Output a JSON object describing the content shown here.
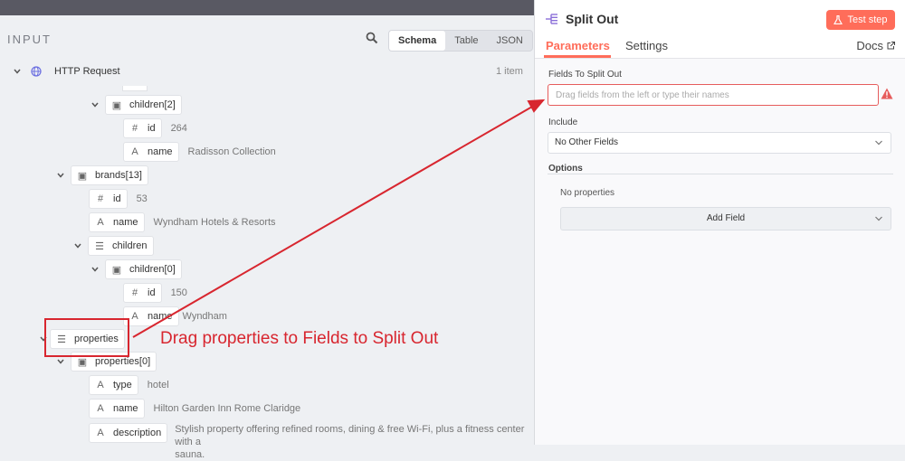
{
  "left_panel": {
    "title": "INPUT",
    "view_tabs": [
      "Schema",
      "Table",
      "JSON"
    ],
    "active_view": "Schema",
    "root": {
      "label": "HTTP Request",
      "count": "1 item"
    },
    "tree": [
      {
        "type": "object",
        "label": "children[2]"
      },
      {
        "type": "number",
        "label": "id",
        "value": "264"
      },
      {
        "type": "string",
        "label": "name",
        "value": "Radisson Collection"
      },
      {
        "type": "object",
        "label": "brands[13]"
      },
      {
        "type": "number",
        "label": "id",
        "value": "53"
      },
      {
        "type": "string",
        "label": "name",
        "value": "Wyndham Hotels & Resorts"
      },
      {
        "type": "list",
        "label": "children"
      },
      {
        "type": "object",
        "label": "children[0]"
      },
      {
        "type": "number",
        "label": "id",
        "value": "150"
      },
      {
        "type": "string",
        "label": "name",
        "value": "Wyndham"
      },
      {
        "type": "list",
        "label": "properties"
      },
      {
        "type": "object",
        "label": "properties[0]"
      },
      {
        "type": "string",
        "label": "type",
        "value": "hotel"
      },
      {
        "type": "string",
        "label": "name",
        "value": "Hilton Garden Inn Rome Claridge"
      },
      {
        "type": "string",
        "label": "description",
        "value": "Stylish property offering refined rooms, dining & free Wi-Fi, plus a fitness center with a",
        "value_cont": "sauna."
      }
    ]
  },
  "right_panel": {
    "node_title": "Split Out",
    "test_button": "Test step",
    "tabs": [
      "Parameters",
      "Settings"
    ],
    "active_tab": "Parameters",
    "docs_label": "Docs",
    "fields_label": "Fields To Split Out",
    "fields_placeholder": "Drag fields from the left or type their names",
    "include_label": "Include",
    "include_value": "No Other Fields",
    "options_label": "Options",
    "no_properties": "No properties",
    "add_field": "Add Field"
  },
  "annotation": {
    "text": "Drag properties to Fields to Split Out"
  },
  "colors": {
    "accent": "#ff6d5a",
    "annotation": "#d8262f",
    "error": "#e65c5c"
  },
  "icons": {
    "number": "#",
    "string": "A",
    "object": "cube-icon",
    "list": "list-icon",
    "root": "globe-icon",
    "node": "split-out-icon",
    "test": "flask-icon",
    "docs": "external-link-icon",
    "warning": "warning-icon"
  }
}
